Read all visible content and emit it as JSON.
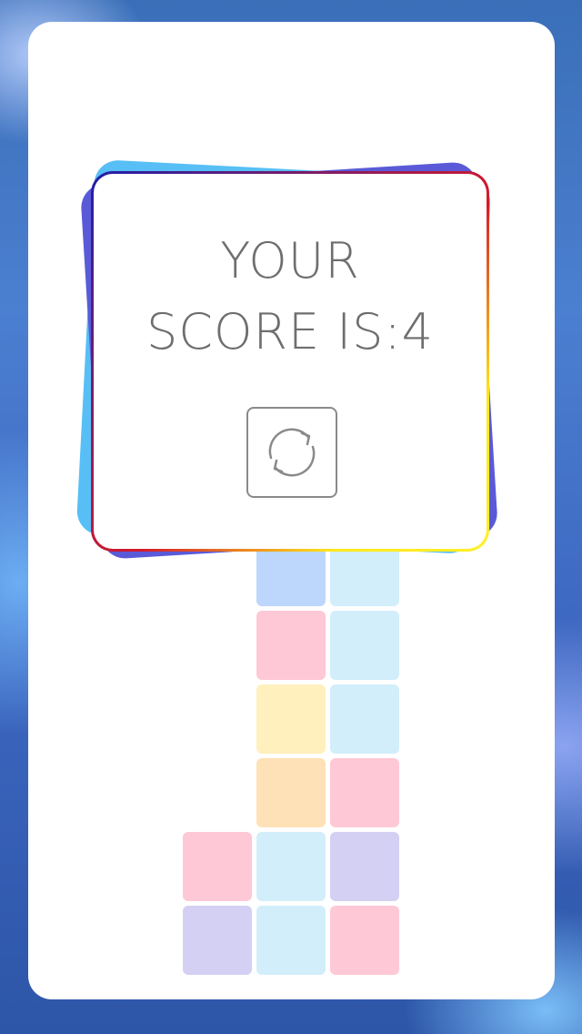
{
  "game_over": {
    "line1": "YOUR",
    "line2_label": "SCORE IS:",
    "score": "4",
    "restart_icon": "refresh-icon"
  },
  "tower": {
    "rows": [
      [
        "",
        "blue",
        "sky"
      ],
      [
        "",
        "pink",
        "sky"
      ],
      [
        "",
        "yellow",
        "sky"
      ],
      [
        "",
        "orange",
        "pink"
      ],
      [
        "pink",
        "sky",
        "violet"
      ],
      [
        "violet",
        "sky",
        "pink"
      ]
    ]
  },
  "colors": {
    "card_border_start": "#1f1fa8",
    "card_border_mid": "#d41a2a",
    "card_border_end": "#ffe81a",
    "layer_cyan": "#57bff5",
    "layer_purple": "#5a5ad8",
    "text": "#6e6e6e"
  }
}
